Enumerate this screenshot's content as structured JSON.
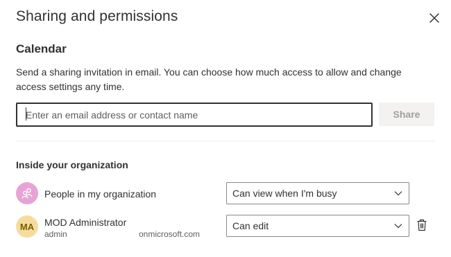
{
  "dialog": {
    "title": "Sharing and permissions"
  },
  "section": {
    "title": "Calendar",
    "description": "Send a sharing invitation in email. You can choose how much access to allow and change access settings any time."
  },
  "invite": {
    "placeholder": "Enter an email address or contact name",
    "value": "",
    "share_label": "Share"
  },
  "organization": {
    "heading": "Inside your organization",
    "people": [
      {
        "name": "People in my organization",
        "avatar_icon": "people-icon",
        "permission": "Can view when I'm busy"
      },
      {
        "name": "MOD Administrator",
        "initials": "MA",
        "email_start": "admin",
        "email_end": "onmicrosoft.com",
        "permission": "Can edit"
      }
    ]
  },
  "colors": {
    "org_avatar": "#e8a3d6",
    "ma_avatar": "#f5dc9e",
    "text": "#323130",
    "disabled_button": "#f3f2f1"
  }
}
